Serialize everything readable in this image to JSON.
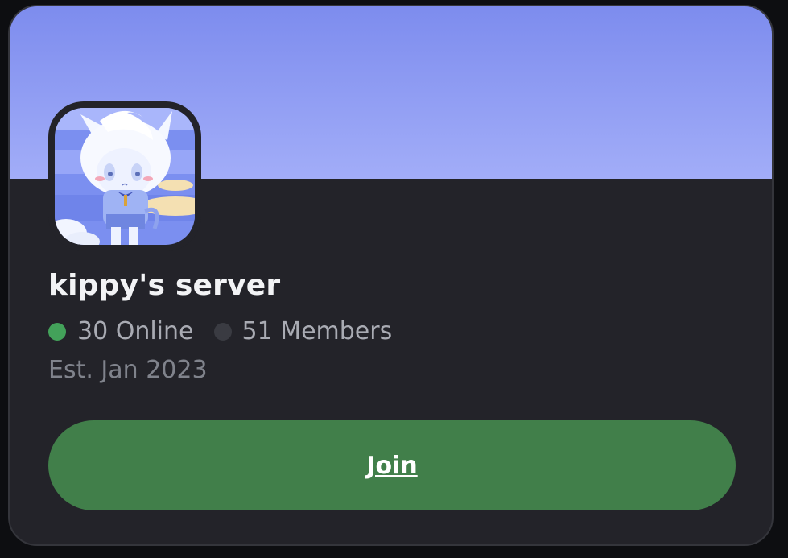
{
  "server": {
    "name": "kippy's server",
    "online_count": "30 Online",
    "member_count": "51 Members",
    "established": "Est. Jan 2023"
  },
  "actions": {
    "join_label": "Join"
  },
  "colors": {
    "banner_top": "#7d8cee",
    "banner_bottom": "#a2adf8",
    "card_background": "#232329",
    "online_dot": "#43a25a",
    "members_dot": "#3a3b42",
    "join_button": "#417f4a"
  },
  "icons": {
    "server_icon": "server-avatar-icon"
  }
}
